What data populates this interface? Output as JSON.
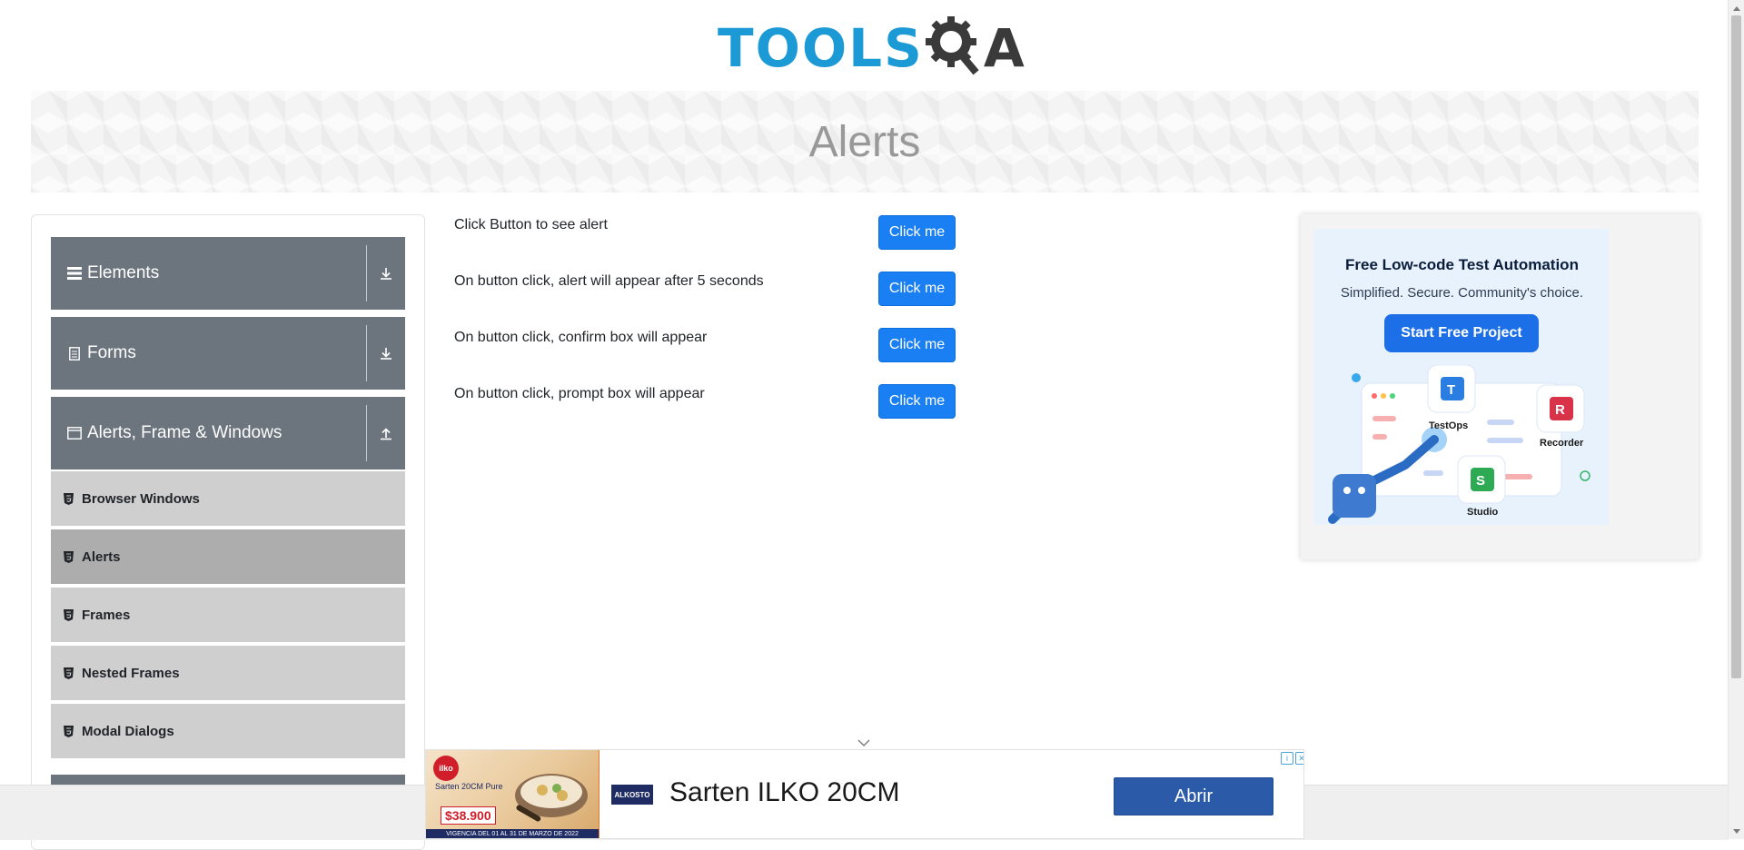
{
  "logo": {
    "text": "TOOLS",
    "text_after": "A",
    "icon": "gear-magnifier-icon",
    "color": "#1c9ad6"
  },
  "banner": {
    "title": "Alerts"
  },
  "sidebar": {
    "groups": [
      {
        "label": "Elements",
        "icon": "hamburger-icon",
        "toggle": "expand-icon"
      },
      {
        "label": "Forms",
        "icon": "form-icon",
        "toggle": "expand-icon"
      },
      {
        "label": "Alerts, Frame & Windows",
        "icon": "window-icon",
        "toggle": "collapse-icon"
      }
    ],
    "items": [
      {
        "label": "Browser Windows",
        "active": false
      },
      {
        "label": "Alerts",
        "active": true
      },
      {
        "label": "Frames",
        "active": false
      },
      {
        "label": "Nested Frames",
        "active": false
      },
      {
        "label": "Modal Dialogs",
        "active": false
      }
    ]
  },
  "main": {
    "rows": [
      {
        "text": "Click Button to see alert",
        "button": "Click me"
      },
      {
        "text": "On button click, alert will appear after 5 seconds",
        "button": "Click me"
      },
      {
        "text": "On button click, confirm box will appear",
        "button": "Click me"
      },
      {
        "text": "On button click, prompt box will appear",
        "button": "Click me"
      }
    ],
    "button_color": "#1a7ff2"
  },
  "right_ad": {
    "title": "Free Low-code Test Automation",
    "subtitle": "Simplified. Secure. Community's choice.",
    "cta": "Start Free Project",
    "products": [
      "TestOps",
      "Recorder",
      "Studio"
    ]
  },
  "bottom_ad": {
    "brand": "ilko",
    "product_mini": "Sarten 20CM Pure",
    "price": "$38.900",
    "validity": "VIGENCIA DEL 01 AL 31 DE MARZO DE 2022",
    "store": "ALKOSTO",
    "headline": "Sarten ILKO 20CM",
    "cta": "Abrir"
  }
}
